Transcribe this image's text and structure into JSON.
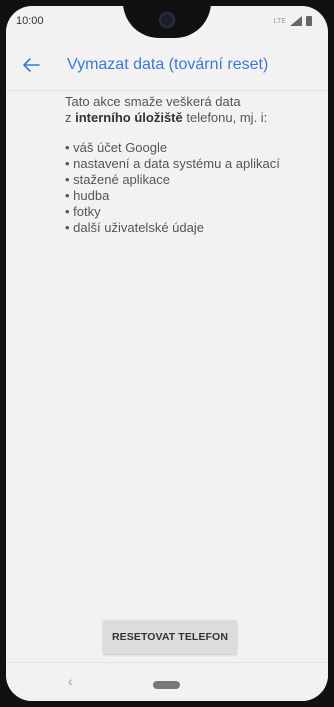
{
  "status_bar": {
    "time": "10:00",
    "network": "LTE",
    "icons": [
      "signal-icon",
      "battery-icon"
    ]
  },
  "app_bar": {
    "title": "Vymazat data (tovární reset)",
    "back_icon": "arrow-left-icon",
    "accent_color": "#3b79d6"
  },
  "content": {
    "intro_line1": "Tato akce smaže veškerá data",
    "intro_prefix": "z ",
    "intro_bold": "interního úložiště",
    "intro_suffix": " telefonu, mj. i:",
    "items": [
      "váš účet Google",
      "nastavení a data systému a aplikací",
      "stažené aplikace",
      "hudba",
      "fotky",
      "další uživatelské údaje"
    ]
  },
  "actions": {
    "reset_label": "RESETOVAT TELEFON"
  },
  "nav_bar": {
    "back_glyph": "‹",
    "home_icon": "home-pill-icon"
  }
}
